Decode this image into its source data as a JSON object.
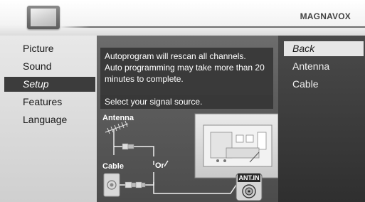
{
  "header": {
    "brand": "MAGNAVOX",
    "tv_icon": "tv-icon"
  },
  "left_menu": {
    "items": [
      {
        "label": "Picture",
        "selected": false
      },
      {
        "label": "Sound",
        "selected": false
      },
      {
        "label": "Setup",
        "selected": true
      },
      {
        "label": "Features",
        "selected": false
      },
      {
        "label": "Language",
        "selected": false
      }
    ]
  },
  "panel": {
    "message_lines": [
      "Autoprogram will rescan all channels.",
      "Auto programming may take more than 20",
      "minutes to complete."
    ],
    "prompt": "Select your signal source.",
    "diagram": {
      "antenna_label": "Antenna",
      "cable_label": "Cable",
      "or_label": "Or",
      "port_label": "ANT.IN"
    }
  },
  "right_menu": {
    "options": [
      {
        "label": "Back",
        "selected": true
      },
      {
        "label": "Antenna",
        "selected": false
      },
      {
        "label": "Cable",
        "selected": false
      }
    ]
  },
  "colors": {
    "selected_left_bg": "#3c3c3c",
    "selected_right_bg": "#e6e6e6",
    "panel_bg": "#5c5c5c",
    "message_bg": "#3a3a3a"
  }
}
